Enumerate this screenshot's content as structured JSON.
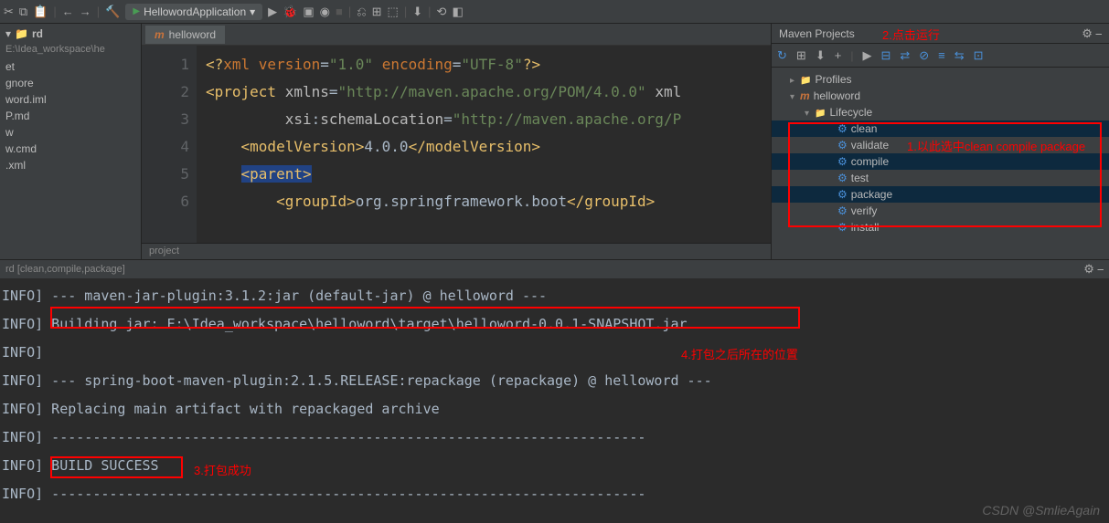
{
  "toolbar": {
    "run_config": "HellowordApplication"
  },
  "sidebar": {
    "title": "rd",
    "path": "E:\\Idea_workspace\\he",
    "items": [
      "et",
      "gnore",
      "word.iml",
      "P.md",
      "w",
      "w.cmd",
      ".xml"
    ]
  },
  "editor": {
    "tab_label": "helloword",
    "lines": [
      {
        "n": 1,
        "html": "<span class='tag'>&lt;?</span><span class='kw'>xml version</span><span class='txt'>=</span><span class='str'>\"1.0\"</span> <span class='kw'>encoding</span><span class='txt'>=</span><span class='str'>\"UTF-8\"</span><span class='tag'>?&gt;</span>"
      },
      {
        "n": 2,
        "html": "<span class='tag'>&lt;project </span><span class='attr'>xmlns</span><span class='txt'>=</span><span class='str'>\"http://maven.apache.org/POM/4.0.0\"</span> <span class='attr'>xml</span>"
      },
      {
        "n": 3,
        "html": "         <span class='attr'>xsi</span><span class='txt'>:</span><span class='attr'>schemaLocation</span><span class='txt'>=</span><span class='str'>\"http://maven.apache.org/P</span>"
      },
      {
        "n": 4,
        "html": "    <span class='tag'>&lt;modelVersion&gt;</span><span class='txt'>4.0.0</span><span class='tag'>&lt;/modelVersion&gt;</span>"
      },
      {
        "n": 5,
        "html": "    <span class='tag hl'>&lt;parent&gt;</span>"
      },
      {
        "n": 6,
        "html": "        <span class='tag'>&lt;groupId&gt;</span><span class='txt'>org.springframework.boot</span><span class='tag'>&lt;/groupId&gt;</span>"
      }
    ],
    "breadcrumb": "project"
  },
  "maven": {
    "title": "Maven Projects",
    "tree": {
      "profiles": "Profiles",
      "project": "helloword",
      "lifecycle": "Lifecycle",
      "goals": [
        "clean",
        "validate",
        "compile",
        "test",
        "package",
        "verify",
        "install"
      ]
    }
  },
  "console": {
    "header": "rd [clean,compile,package]",
    "lines": [
      "INFO] --- maven-jar-plugin:3.1.2:jar (default-jar) @ helloword ---",
      "INFO] Building jar: E:\\Idea_workspace\\helloword\\target\\helloword-0.0.1-SNAPSHOT.jar",
      "INFO]",
      "INFO] --- spring-boot-maven-plugin:2.1.5.RELEASE:repackage (repackage) @ helloword ---",
      "INFO] Replacing main artifact with repackaged archive",
      "INFO] ------------------------------------------------------------------------",
      "INFO] BUILD SUCCESS",
      "INFO] ------------------------------------------------------------------------"
    ]
  },
  "annotations": {
    "a1": "1.以此选中clean compile package",
    "a2": "2.点击运行",
    "a3": "3.打包成功",
    "a4": "4.打包之后所在的位置"
  },
  "watermark": "CSDN @SmlieAgain"
}
